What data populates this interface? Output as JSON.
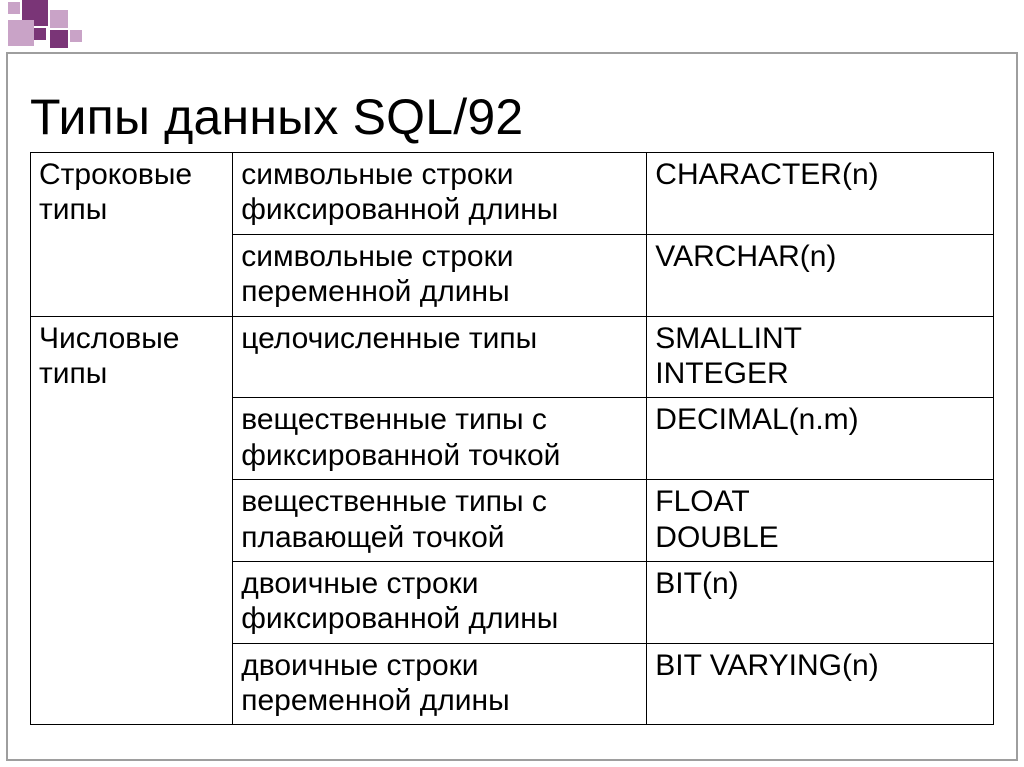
{
  "title": "Типы данных SQL/92",
  "table": {
    "groups": [
      {
        "name": "Строковые типы",
        "rows": [
          {
            "desc": "символьные строки фиксированной длины",
            "types": [
              "CHARACTER(n)"
            ]
          },
          {
            "desc": "символьные строки переменной длины",
            "types": [
              "VARCHAR(n)"
            ]
          }
        ]
      },
      {
        "name": "Числовые типы",
        "rows": [
          {
            "desc": "целочисленные типы",
            "types": [
              "SMALLINT",
              "INTEGER"
            ]
          },
          {
            "desc": "вещественные типы с фиксированной точкой",
            "types": [
              "DECIMAL(n.m)"
            ]
          },
          {
            "desc": "вещественные типы с плавающей точкой",
            "types": [
              "FLOAT",
              "DOUBLE"
            ]
          },
          {
            "desc": "двоичные строки фиксированной длины",
            "types": [
              "BIT(n)"
            ]
          },
          {
            "desc": "двоичные строки переменной длины",
            "types": [
              "BIT VARYING(n)"
            ]
          }
        ]
      }
    ]
  }
}
